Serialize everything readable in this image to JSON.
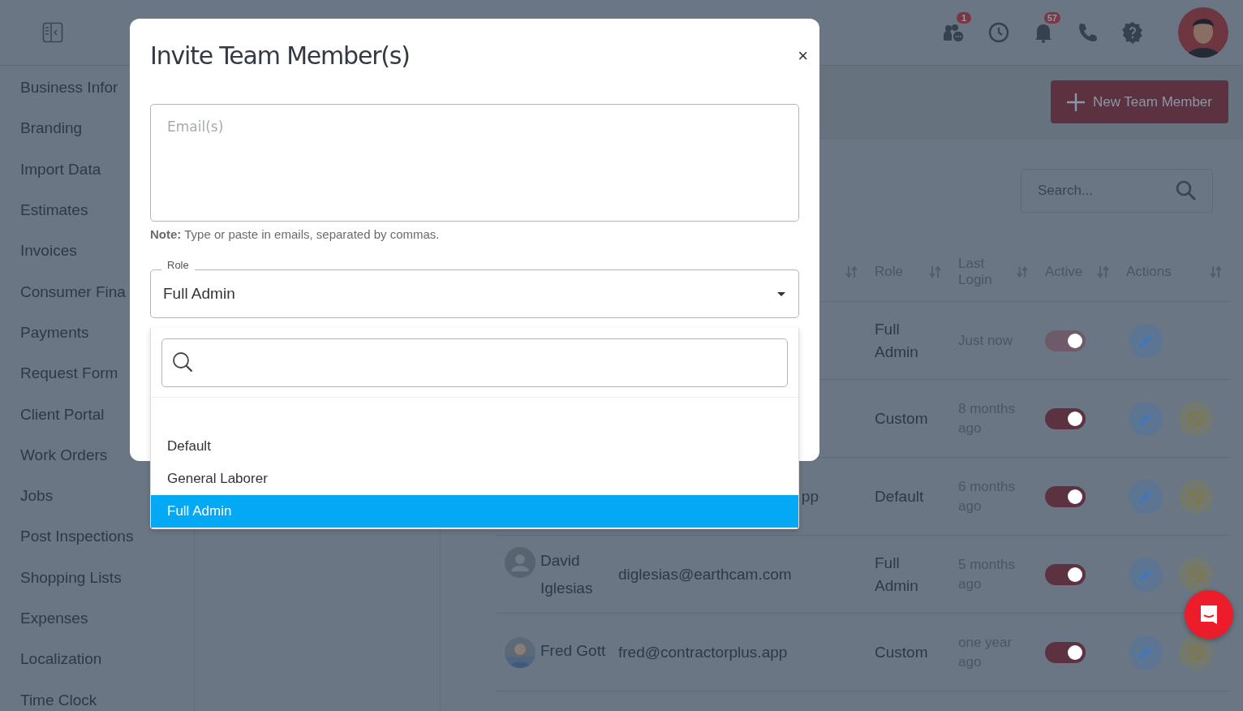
{
  "topbar": {
    "icons": [
      {
        "kind": "team",
        "badge": "1"
      },
      {
        "kind": "clock"
      },
      {
        "kind": "bell",
        "badge": "57"
      },
      {
        "kind": "phone"
      },
      {
        "kind": "help"
      }
    ]
  },
  "sidebar": {
    "items": [
      "Business Infor",
      "Branding",
      "Import Data",
      "Estimates",
      "Invoices",
      "Consumer Fina",
      "Payments",
      "Request Form",
      "Client Portal",
      "Work Orders",
      "Jobs",
      "Post Inspections",
      "Shopping Lists",
      "Expenses",
      "Localization",
      "Time Clock"
    ]
  },
  "new_member_button": "New Team Member",
  "search": {
    "placeholder": "Search..."
  },
  "table": {
    "columns": [
      "Role",
      "Last Login",
      "Active",
      "Actions"
    ],
    "rows": [
      {
        "name": "",
        "email": "",
        "email_cut": false,
        "role": "Full Admin",
        "last_login": "Just now",
        "active": true,
        "disabled": true,
        "blockable": false
      },
      {
        "name": "",
        "email": "",
        "email_cut": false,
        "role": "Custom",
        "last_login": "8 months ago",
        "active": true,
        "disabled": false,
        "blockable": true
      },
      {
        "name": "",
        "email": "pp",
        "email_cut": true,
        "role": "Default",
        "last_login": "6 months ago",
        "active": true,
        "disabled": false,
        "blockable": true
      },
      {
        "name": "David Iglesias",
        "avatar": {
          "kind": "generic"
        },
        "email": "diglesias@earthcam.com",
        "email_cut": false,
        "role": "Full Admin",
        "last_login": "5 months ago",
        "active": true,
        "disabled": false,
        "blockable": true
      },
      {
        "name": "Fred Gott",
        "email": "fred@contractorplus.app",
        "email_cut": false,
        "role": "Custom",
        "last_login": "one year ago",
        "active": true,
        "disabled": false,
        "blockable": true
      }
    ]
  },
  "modal": {
    "title": "Invite Team Member(s)",
    "close": "×",
    "emails": {
      "placeholder": "Email(s)"
    },
    "note": "**Note:** Type or paste in emails, separated by commas.",
    "role": {
      "label": "Role",
      "value": "Full Admin",
      "options": [
        {
          "label": "Default",
          "selected": false
        },
        {
          "label": "General Laborer",
          "selected": false
        },
        {
          "label": "Full Admin",
          "selected": true
        }
      ]
    }
  }
}
